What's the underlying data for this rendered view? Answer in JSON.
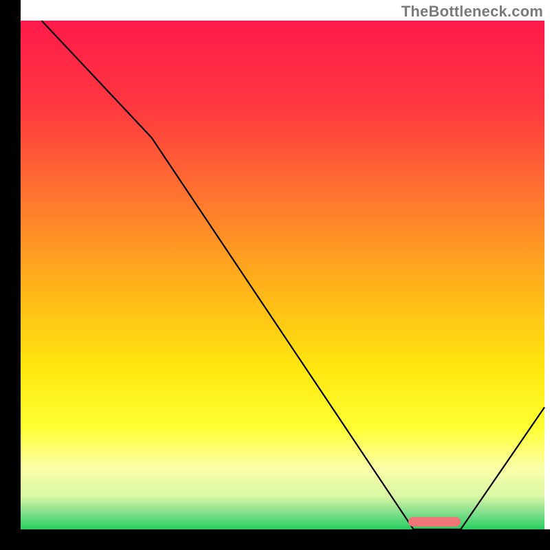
{
  "attribution": "TheBottleneck.com",
  "chart_data": {
    "type": "line",
    "title": "",
    "xlabel": "",
    "ylabel": "",
    "xlim": [
      0,
      100
    ],
    "ylim": [
      0,
      100
    ],
    "series": [
      {
        "name": "bottleneck-curve",
        "x": [
          4,
          25,
          75,
          84,
          100
        ],
        "y": [
          100,
          77,
          0,
          0,
          24
        ]
      }
    ],
    "optimal_marker": {
      "x_start": 74,
      "x_end": 84,
      "y": 1.5
    },
    "background_gradient": {
      "stops": [
        {
          "pos": 0.0,
          "color": "#ff1a4b"
        },
        {
          "pos": 0.18,
          "color": "#ff3b3f"
        },
        {
          "pos": 0.36,
          "color": "#ff7a2e"
        },
        {
          "pos": 0.52,
          "color": "#ffb21a"
        },
        {
          "pos": 0.68,
          "color": "#ffe60f"
        },
        {
          "pos": 0.8,
          "color": "#ffff33"
        },
        {
          "pos": 0.88,
          "color": "#fbffa8"
        },
        {
          "pos": 0.935,
          "color": "#d9f7a5"
        },
        {
          "pos": 0.965,
          "color": "#88e08f"
        },
        {
          "pos": 1.0,
          "color": "#27cf5f"
        }
      ]
    },
    "marker_color": "#ef7579"
  },
  "layout": {
    "margin_left": 30,
    "margin_right": 8,
    "margin_top": 30,
    "margin_bottom": 30,
    "axis_width": 30
  }
}
